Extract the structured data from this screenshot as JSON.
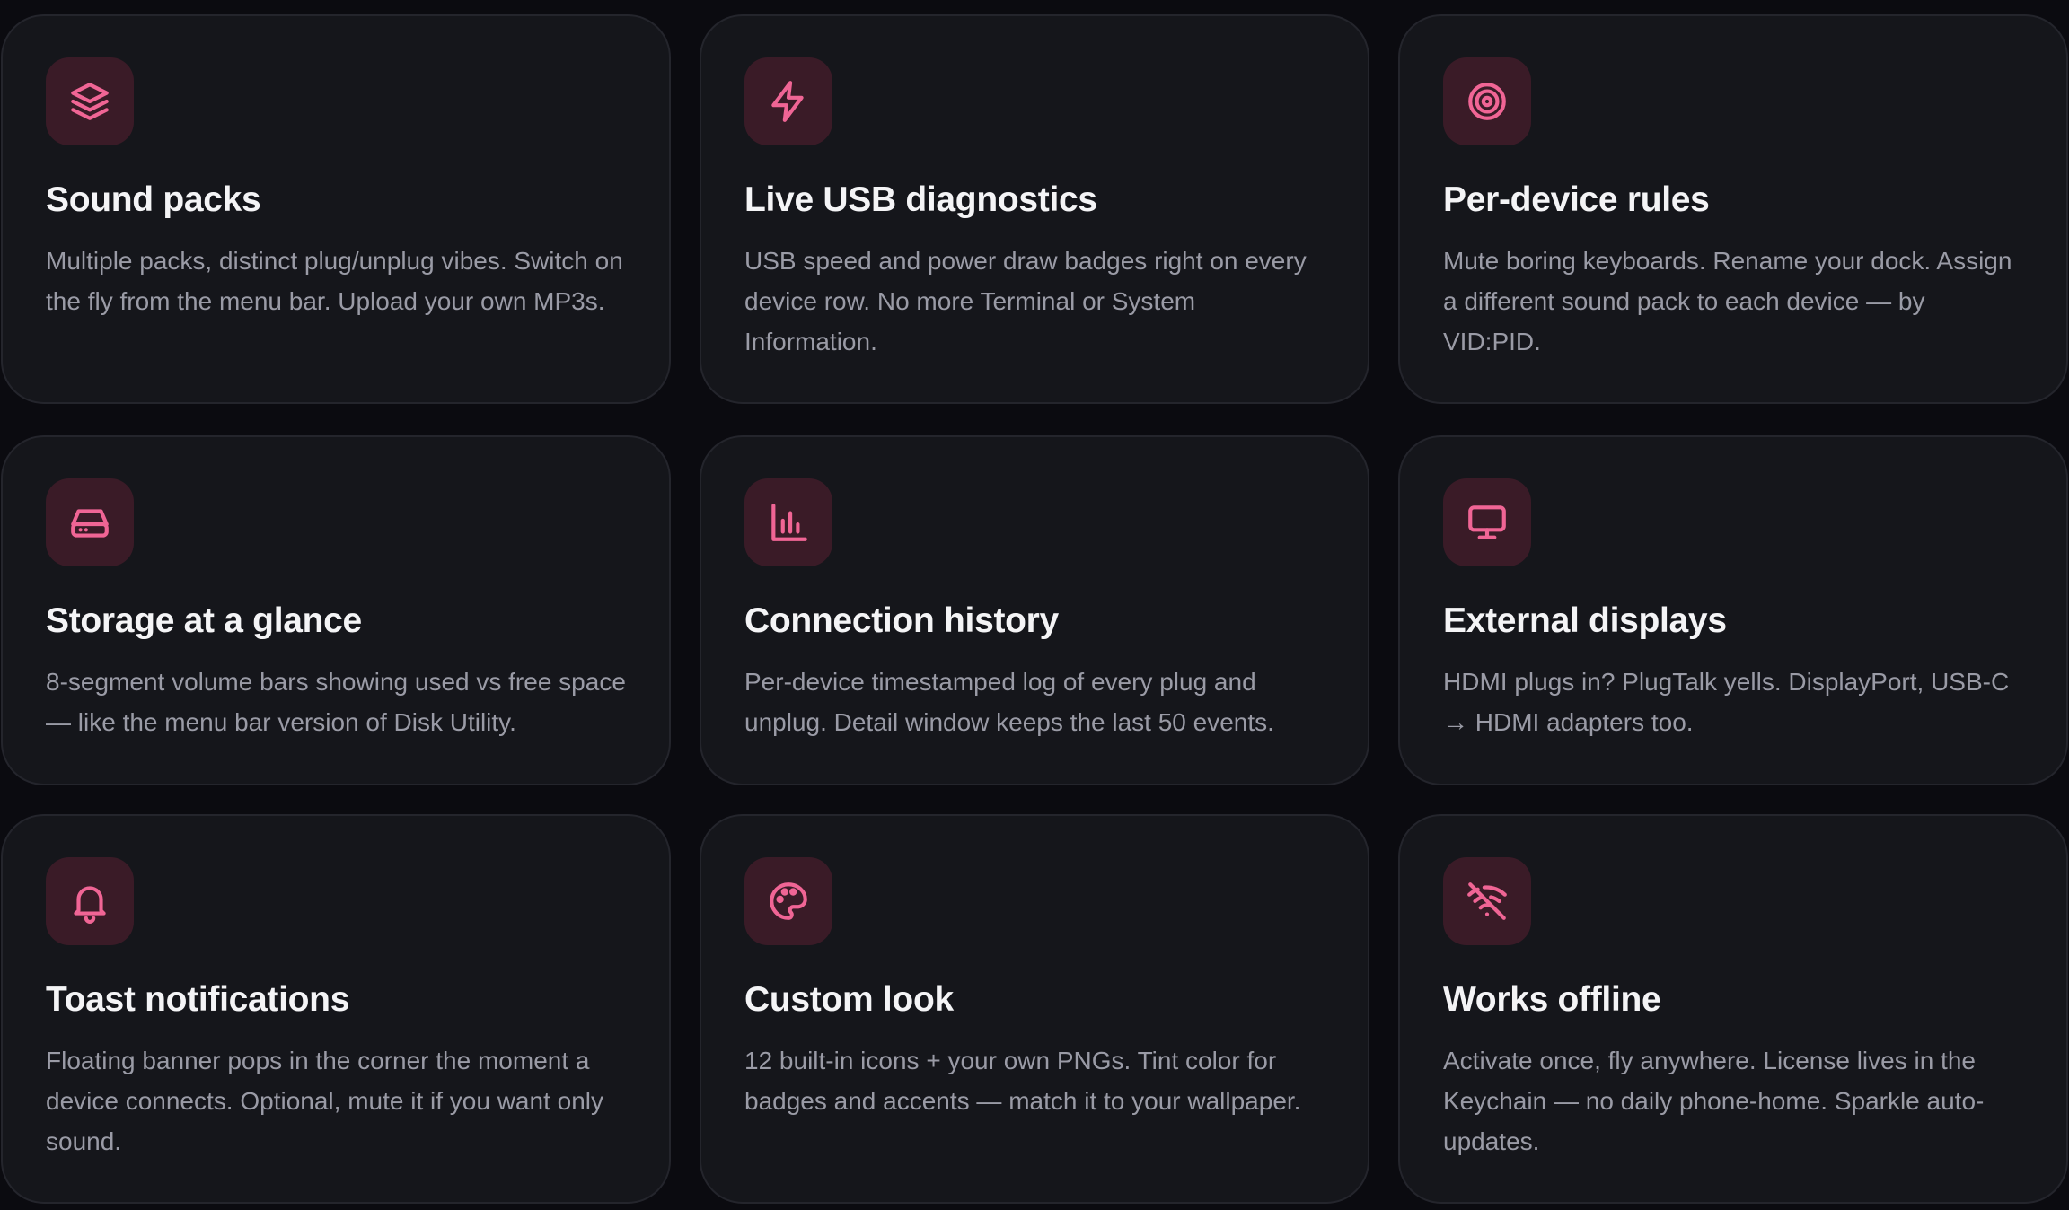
{
  "accent_color": "#f06595",
  "card_background": "#15161b",
  "page_background": "#0b0b10",
  "features": [
    {
      "icon": "layers-icon",
      "title": "Sound packs",
      "description": "Multiple packs, distinct plug/unplug vibes. Switch on the fly from the menu bar. Upload your own MP3s."
    },
    {
      "icon": "lightning-icon",
      "title": "Live USB diagnostics",
      "description": "USB speed and power draw badges right on every device row. No more Terminal or System Information."
    },
    {
      "icon": "target-icon",
      "title": "Per-device rules",
      "description": "Mute boring keyboards. Rename your dock. Assign a different sound pack to each device — by VID:PID."
    },
    {
      "icon": "hard-drive-icon",
      "title": "Storage at a glance",
      "description": "8-segment volume bars showing used vs free space — like the menu bar version of Disk Utility."
    },
    {
      "icon": "bar-chart-icon",
      "title": "Connection history",
      "description": "Per-device timestamped log of every plug and unplug. Detail window keeps the last 50 events."
    },
    {
      "icon": "monitor-icon",
      "title": "External displays",
      "description": "HDMI plugs in? PlugTalk yells. DisplayPort, USB-C → HDMI adapters too."
    },
    {
      "icon": "bell-icon",
      "title": "Toast notifications",
      "description": "Floating banner pops in the corner the moment a device connects. Optional, mute it if you want only sound."
    },
    {
      "icon": "palette-icon",
      "title": "Custom look",
      "description": "12 built-in icons + your own PNGs. Tint color for badges and accents — match it to your wallpaper."
    },
    {
      "icon": "wifi-off-icon",
      "title": "Works offline",
      "description": "Activate once, fly anywhere. License lives in the Keychain — no daily phone-home. Sparkle auto-updates."
    }
  ]
}
